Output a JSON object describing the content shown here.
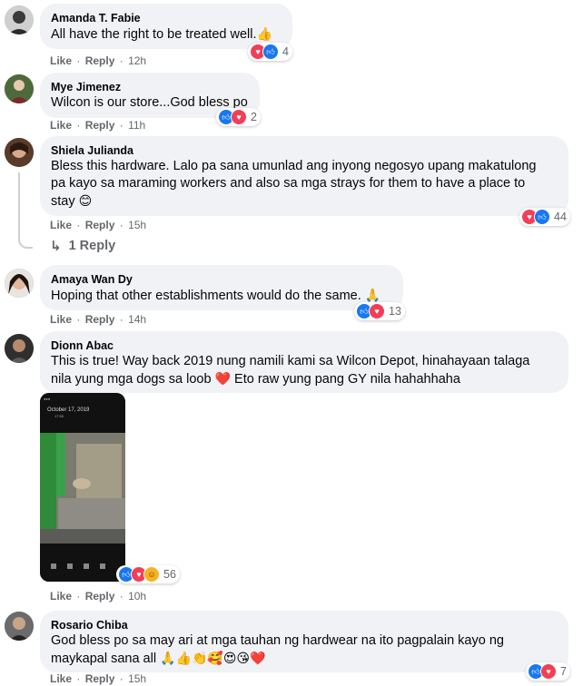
{
  "colors": {
    "like": "#1877f2",
    "love": "#f33e58",
    "haha": "#f7b125",
    "bubble": "#f0f2f5",
    "meta": "#65676b"
  },
  "actions": {
    "like": "Like",
    "reply": "Reply",
    "sep": "·"
  },
  "comments": [
    {
      "name": "Amanda T. Fabie",
      "text": "All have the right to be treated well.",
      "emoji": "👍",
      "time": "12h",
      "reactions": [
        "love-icon",
        "like-icon"
      ],
      "count": "4"
    },
    {
      "name": "Mye Jimenez",
      "text": "Wilcon is our store...God bless po",
      "time": "11h",
      "reactions": [
        "like-icon",
        "love-icon"
      ],
      "count": "2"
    },
    {
      "name": "Shiela Julianda",
      "lines": [
        "Bless this hardware. Lalo pa sana umunlad ang inyong negosyo upang makatulong",
        "pa kayo sa maraming workers and also sa mga strays for them to have a place to",
        "stay"
      ],
      "emoji": "😊",
      "time": "15h",
      "reactions": [
        "love-icon",
        "like-icon"
      ],
      "count": "44",
      "replies": "1 Reply"
    },
    {
      "name": "Amaya Wan Dy",
      "text": "Hoping that other establishments would do the same.",
      "emoji": "🙏",
      "time": "14h",
      "reactions": [
        "like-icon",
        "love-icon"
      ],
      "count": "13"
    },
    {
      "name": "Dionn Abac",
      "lines": [
        "This is true! Way back 2019 nung namili kami sa Wilcon Depot, hinahayaan talaga",
        "nila yung mga dogs sa loob",
        "Eto raw yung pang GY nila hahahhaha"
      ],
      "emoji": "❤️",
      "time": "10h",
      "reactions": [
        "like-icon",
        "love-icon",
        "haha-icon"
      ],
      "count": "56",
      "photo": {
        "date": "October 17, 2019",
        "time": "17:50"
      }
    },
    {
      "name": "Rosario Chiba",
      "lines": [
        "God bless po sa may ari at mga tauhan ng hardwear na ito pagpalain kayo ng",
        "maykapal sana all"
      ],
      "emojis": "🙏👍👏🥰😍😘❤️",
      "time": "15h",
      "reactions": [
        "like-icon",
        "love-icon"
      ],
      "count": "7"
    }
  ]
}
